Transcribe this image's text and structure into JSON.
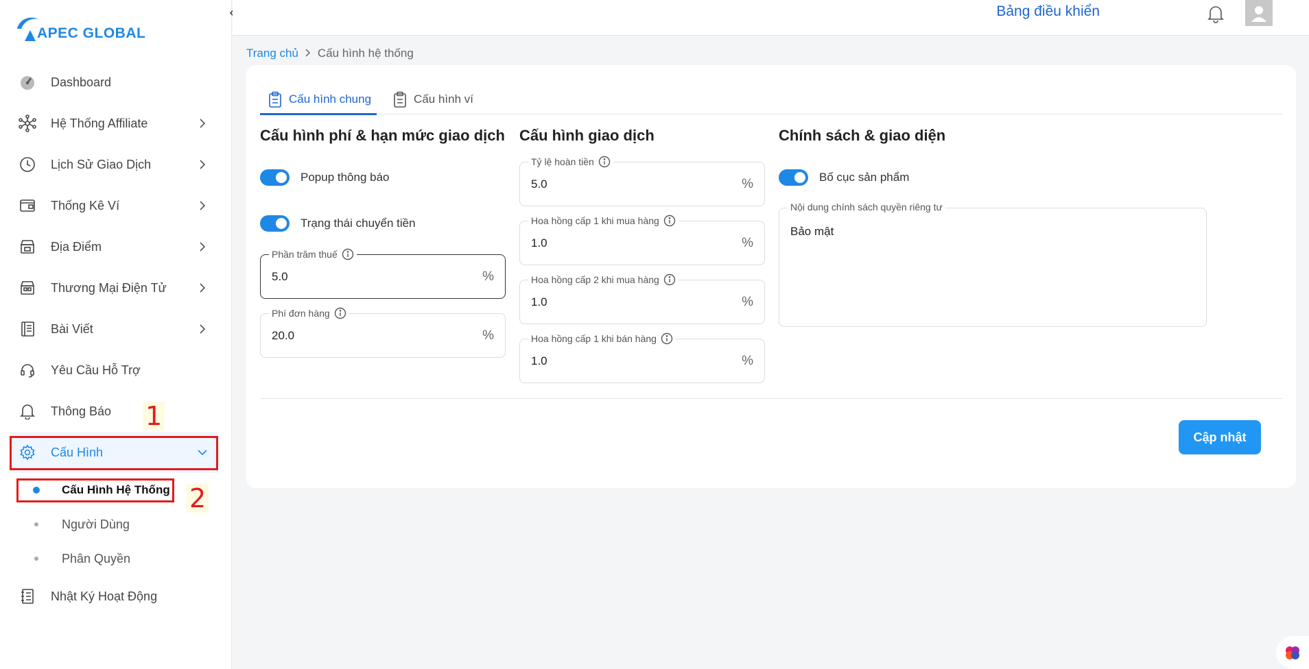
{
  "brand": {
    "name": "APEC GLOBAL",
    "color": "#1e88e5"
  },
  "header": {
    "title": "Bảng điều khiển"
  },
  "sidebar": {
    "items": [
      {
        "label": "Dashboard",
        "icon": "dashboard-gauge-icon",
        "has_chevron": false
      },
      {
        "label": "Hệ Thống Affiliate",
        "icon": "network-icon",
        "has_chevron": true
      },
      {
        "label": "Lịch Sử Giao Dịch",
        "icon": "history-clock-icon",
        "has_chevron": true
      },
      {
        "label": "Thống Kê Ví",
        "icon": "wallet-icon",
        "has_chevron": true
      },
      {
        "label": "Địa Điểm",
        "icon": "store-icon",
        "has_chevron": true
      },
      {
        "label": "Thương Mại Điện Tử",
        "icon": "shop-icon",
        "has_chevron": true
      },
      {
        "label": "Bài Viết",
        "icon": "notebook-icon",
        "has_chevron": true
      },
      {
        "label": "Yêu Cầu Hỗ Trợ",
        "icon": "headset-icon",
        "has_chevron": false
      },
      {
        "label": "Thông Báo",
        "icon": "bell-icon",
        "has_chevron": false
      },
      {
        "label": "Cấu Hình",
        "icon": "gear-icon",
        "has_chevron": true,
        "expanded": true,
        "active": true
      }
    ],
    "submenu": [
      {
        "label": "Cấu Hình Hệ Thống",
        "current": true
      },
      {
        "label": "Người Dùng",
        "current": false
      },
      {
        "label": "Phân Quyền",
        "current": false
      }
    ],
    "last_item": {
      "label": "Nhật Ký Hoạt Động",
      "icon": "log-book-icon"
    }
  },
  "annotations": {
    "one": "1",
    "two": "2",
    "color": "#e31b1b"
  },
  "breadcrumb": {
    "home": "Trang chủ",
    "current": "Cấu hình hệ thống"
  },
  "tabs": [
    {
      "label": "Cấu hình chung",
      "active": true
    },
    {
      "label": "Cấu hình ví",
      "active": false
    }
  ],
  "fees": {
    "title": "Cấu hình phí & hạn mức giao dịch",
    "popup_toggle": {
      "label": "Popup thông báo",
      "on": true
    },
    "transfer_toggle": {
      "label": "Trạng thái chuyển tiền",
      "on": true
    },
    "tax_percent": {
      "label": "Phần trăm thuế",
      "value": "5.0",
      "unit": "%"
    },
    "order_fee": {
      "label": "Phí đơn hàng",
      "value": "20.0",
      "unit": "%"
    }
  },
  "transaction": {
    "title": "Cấu hình giao dịch",
    "refund_rate": {
      "label": "Tỷ lệ hoàn tiền",
      "value": "5.0",
      "unit": "%"
    },
    "commission_l1_buy": {
      "label": "Hoa hồng cấp 1 khi mua hàng",
      "value": "1.0",
      "unit": "%"
    },
    "commission_l2_buy": {
      "label": "Hoa hồng cấp 2 khi mua hàng",
      "value": "1.0",
      "unit": "%"
    },
    "commission_l1_sell": {
      "label": "Hoa hồng cấp 1 khi bán hàng",
      "value": "1.0",
      "unit": "%"
    }
  },
  "policy": {
    "title": "Chính sách & giao diện",
    "layout_toggle": {
      "label": "Bố cục sản phẩm",
      "on": true
    },
    "privacy_content": {
      "label": "Nội dung chính sách quyền riêng tư",
      "value": "Bảo mật"
    }
  },
  "actions": {
    "update_label": "Cập nhật",
    "accent": "#2196f3"
  }
}
